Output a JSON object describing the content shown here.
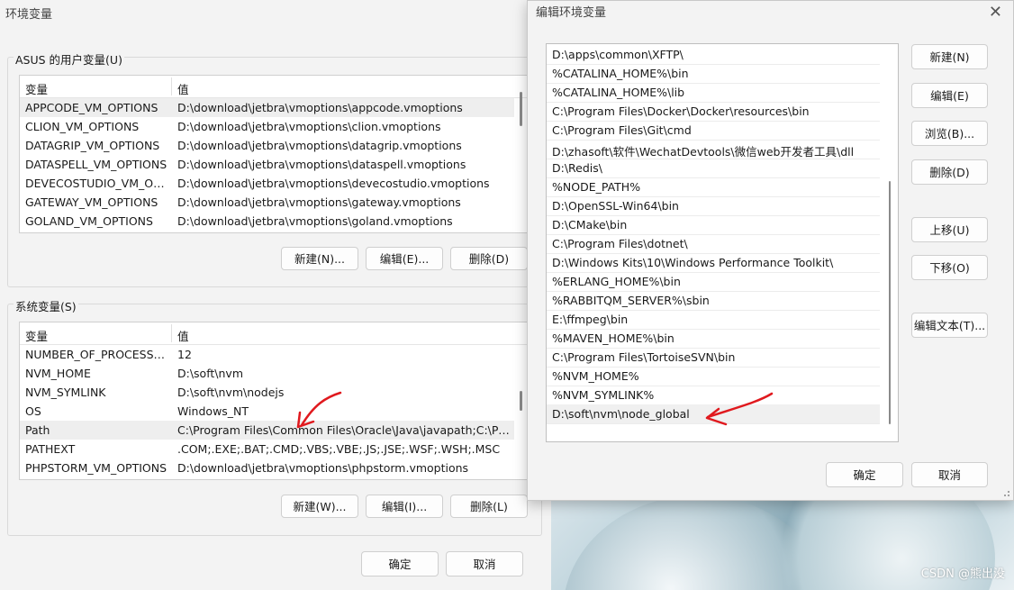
{
  "left_window": {
    "title": "环境变量",
    "user_group": {
      "label": "ASUS 的用户变量(U)",
      "col_var": "变量",
      "col_val": "值",
      "rows": [
        {
          "name": "APPCODE_VM_OPTIONS",
          "value": "D:\\download\\jetbra\\vmoptions\\appcode.vmoptions"
        },
        {
          "name": "CLION_VM_OPTIONS",
          "value": "D:\\download\\jetbra\\vmoptions\\clion.vmoptions"
        },
        {
          "name": "DATAGRIP_VM_OPTIONS",
          "value": "D:\\download\\jetbra\\vmoptions\\datagrip.vmoptions"
        },
        {
          "name": "DATASPELL_VM_OPTIONS",
          "value": "D:\\download\\jetbra\\vmoptions\\dataspell.vmoptions"
        },
        {
          "name": "DEVECOSTUDIO_VM_OPT...",
          "value": "D:\\download\\jetbra\\vmoptions\\devecostudio.vmoptions"
        },
        {
          "name": "GATEWAY_VM_OPTIONS",
          "value": "D:\\download\\jetbra\\vmoptions\\gateway.vmoptions"
        },
        {
          "name": "GOLAND_VM_OPTIONS",
          "value": "D:\\download\\jetbra\\vmoptions\\goland.vmoptions"
        }
      ],
      "new_label": "新建(N)...",
      "edit_label": "编辑(E)...",
      "delete_label": "删除(D)"
    },
    "system_group": {
      "label": "系统变量(S)",
      "col_var": "变量",
      "col_val": "值",
      "rows": [
        {
          "name": "NUMBER_OF_PROCESSORS",
          "value": "12"
        },
        {
          "name": "NVM_HOME",
          "value": "D:\\soft\\nvm"
        },
        {
          "name": "NVM_SYMLINK",
          "value": "D:\\soft\\nvm\\nodejs"
        },
        {
          "name": "OS",
          "value": "Windows_NT"
        },
        {
          "name": "Path",
          "value": "C:\\Program Files\\Common Files\\Oracle\\Java\\javapath;C:\\Prog..."
        },
        {
          "name": "PATHEXT",
          "value": ".COM;.EXE;.BAT;.CMD;.VBS;.VBE;.JS;.JSE;.WSF;.WSH;.MSC"
        },
        {
          "name": "PHPSTORM_VM_OPTIONS",
          "value": "D:\\download\\jetbra\\vmoptions\\phpstorm.vmoptions"
        }
      ],
      "new_label": "新建(W)...",
      "edit_label": "编辑(I)...",
      "delete_label": "删除(L)"
    },
    "ok_label": "确定",
    "cancel_label": "取消"
  },
  "right_window": {
    "title": "编辑环境变量",
    "paths": [
      "D:\\apps\\common\\XFTP\\",
      "%CATALINA_HOME%\\bin",
      "%CATALINA_HOME%\\lib",
      "C:\\Program Files\\Docker\\Docker\\resources\\bin",
      "C:\\Program Files\\Git\\cmd",
      "D:\\zhasoft\\软件\\WechatDevtools\\微信web开发者工具\\dll",
      "D:\\Redis\\",
      "%NODE_PATH%",
      "D:\\OpenSSL-Win64\\bin",
      "D:\\CMake\\bin",
      "C:\\Program Files\\dotnet\\",
      "D:\\Windows Kits\\10\\Windows Performance Toolkit\\",
      "%ERLANG_HOME%\\bin",
      "%RABBITQM_SERVER%\\sbin",
      "E:\\ffmpeg\\bin",
      "%MAVEN_HOME%\\bin",
      "C:\\Program Files\\TortoiseSVN\\bin",
      "%NVM_HOME%",
      "%NVM_SYMLINK%",
      "D:\\soft\\nvm\\node_global"
    ],
    "buttons": {
      "new": "新建(N)",
      "edit": "编辑(E)",
      "browse": "浏览(B)...",
      "delete": "删除(D)",
      "up": "上移(U)",
      "down": "下移(O)",
      "edit_text": "编辑文本(T)..."
    },
    "ok_label": "确定",
    "cancel_label": "取消"
  },
  "watermark": "CSDN @熊出没",
  "annotation_color": "#e0191e",
  "icons": {
    "close": "close-icon",
    "resize": "resize-grip-icon"
  }
}
